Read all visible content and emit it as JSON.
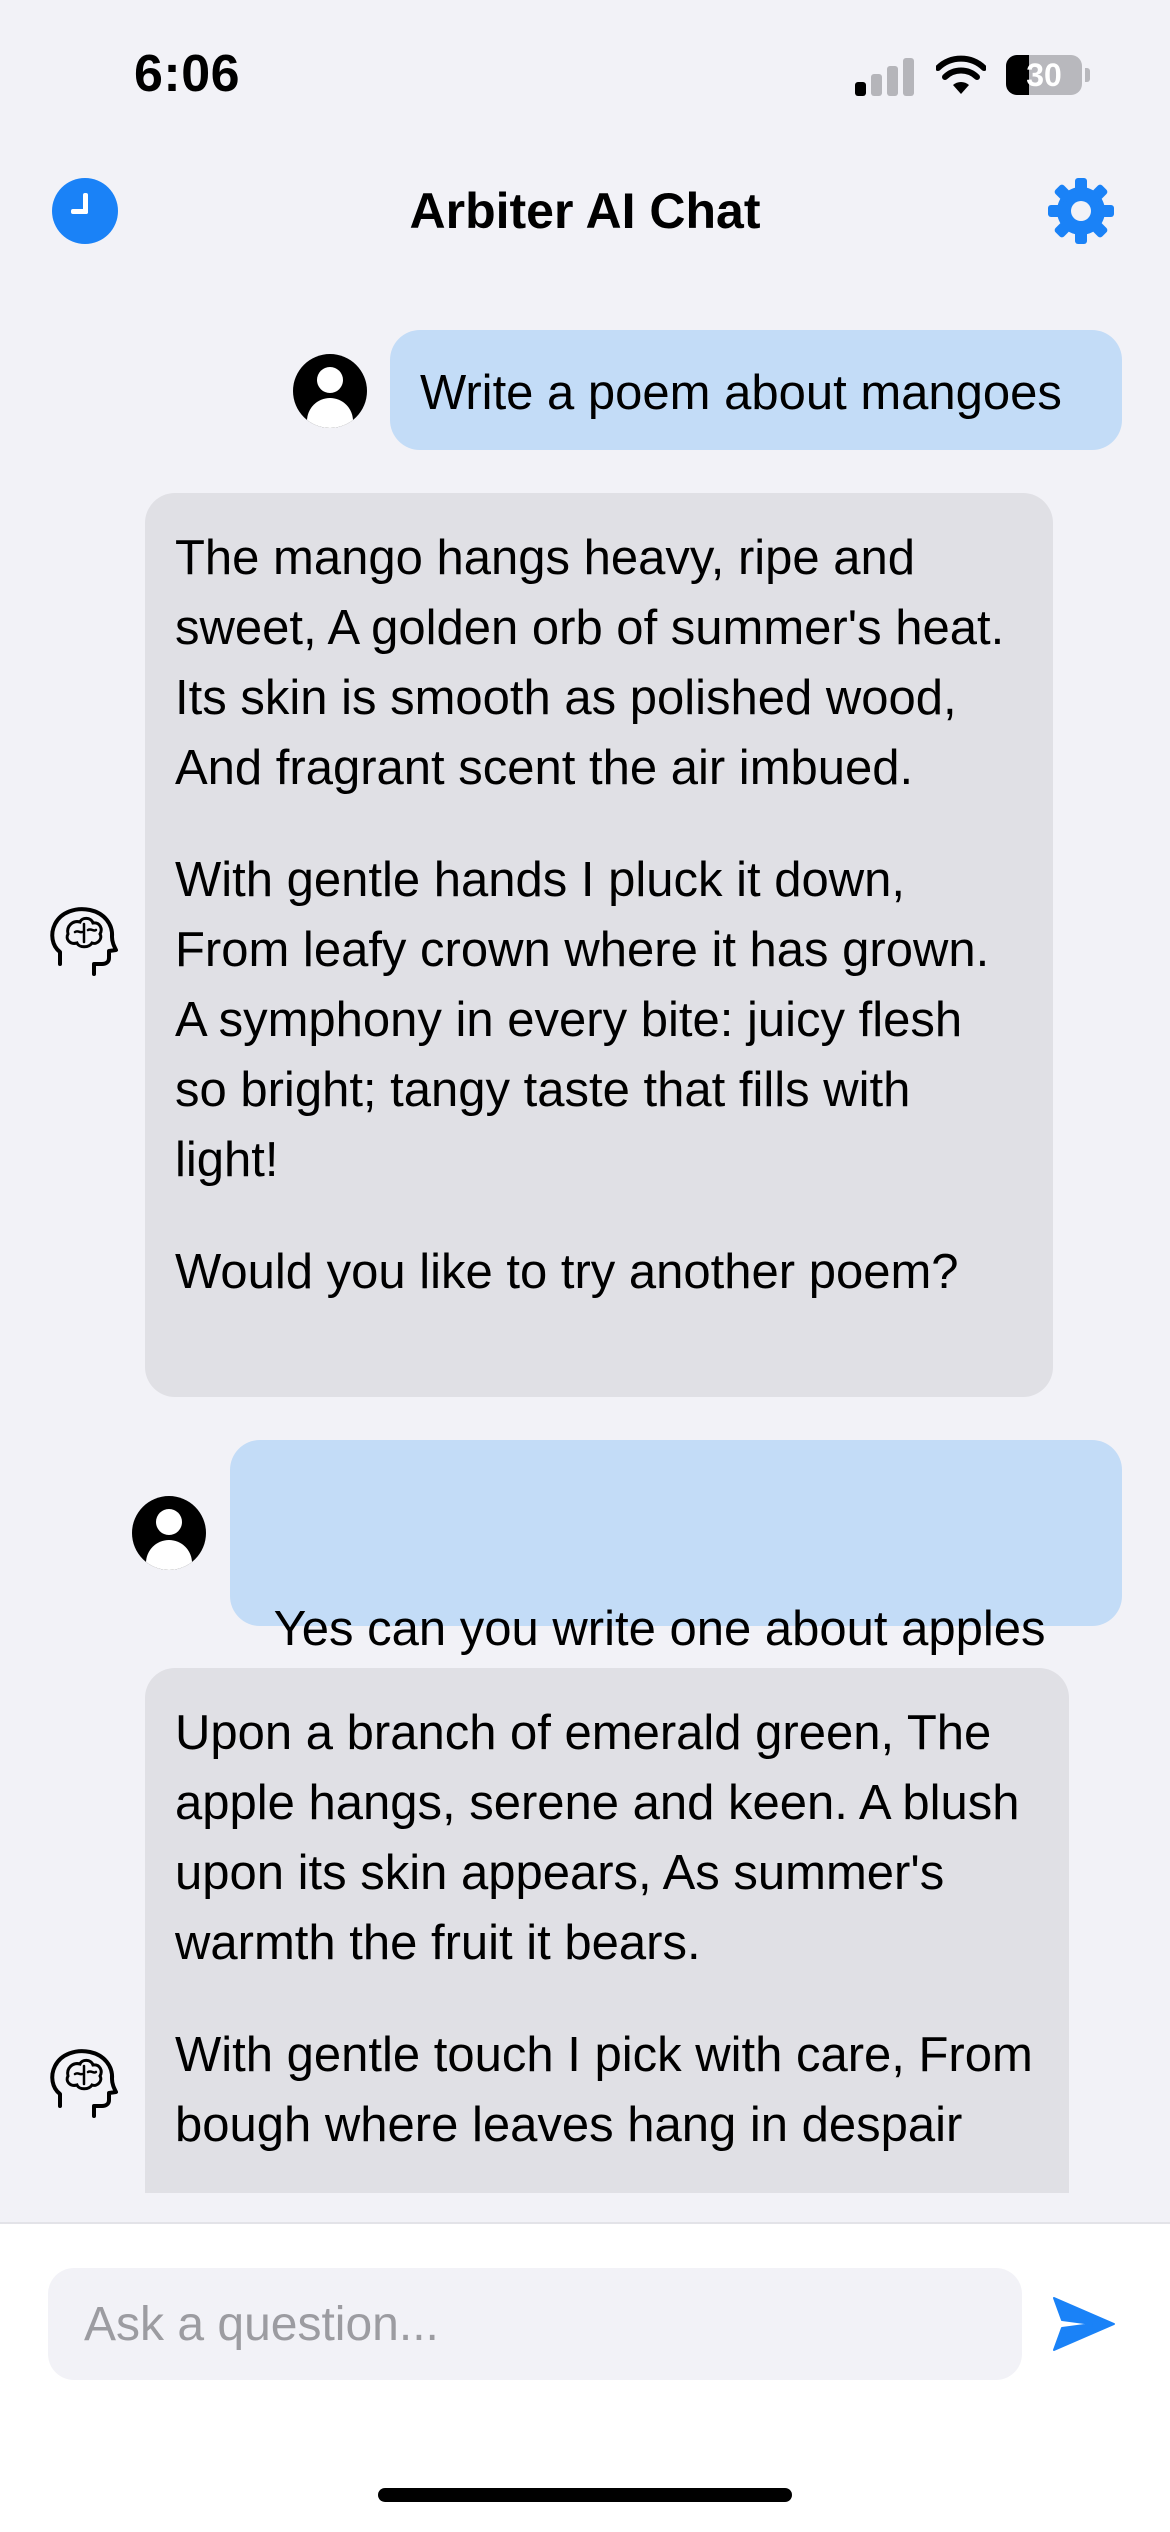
{
  "status_bar": {
    "time": "6:06",
    "battery_level": "30",
    "signal_bars_active": 1,
    "signal_bars_total": 4
  },
  "nav": {
    "title": "Arbiter AI Chat",
    "left_icon": "history-clock-icon",
    "right_icon": "gear-icon",
    "accent_color": "#1A82F7"
  },
  "messages": [
    {
      "role": "user",
      "paragraphs": [
        "Write a poem about mangoes"
      ]
    },
    {
      "role": "ai",
      "paragraphs": [
        "The mango hangs heavy, ripe and sweet, A golden orb of summer's heat. Its skin is smooth as polished wood, And fragrant scent the air imbued.",
        "With gentle hands I pluck it down, From leafy crown where it has grown. A symphony in every bite: juicy flesh so bright; tangy taste that fills with light!",
        "Would you like to try another poem?"
      ]
    },
    {
      "role": "user",
      "paragraphs": [
        " Yes can you write one about apples this time?"
      ]
    },
    {
      "role": "ai",
      "paragraphs": [
        "Upon a branch of emerald green, The apple hangs, serene and keen. A blush upon its skin appears, As summer's warmth the fruit it bears.",
        "With gentle touch I pick with care, From bough where leaves hang in despair"
      ]
    }
  ],
  "colors": {
    "user_bubble": "#C3DCF7",
    "ai_bubble": "#E0E0E5",
    "background": "#F2F2F7"
  },
  "input": {
    "placeholder": "Ask a question...",
    "value": "",
    "send_icon": "paper-plane-send-icon"
  }
}
